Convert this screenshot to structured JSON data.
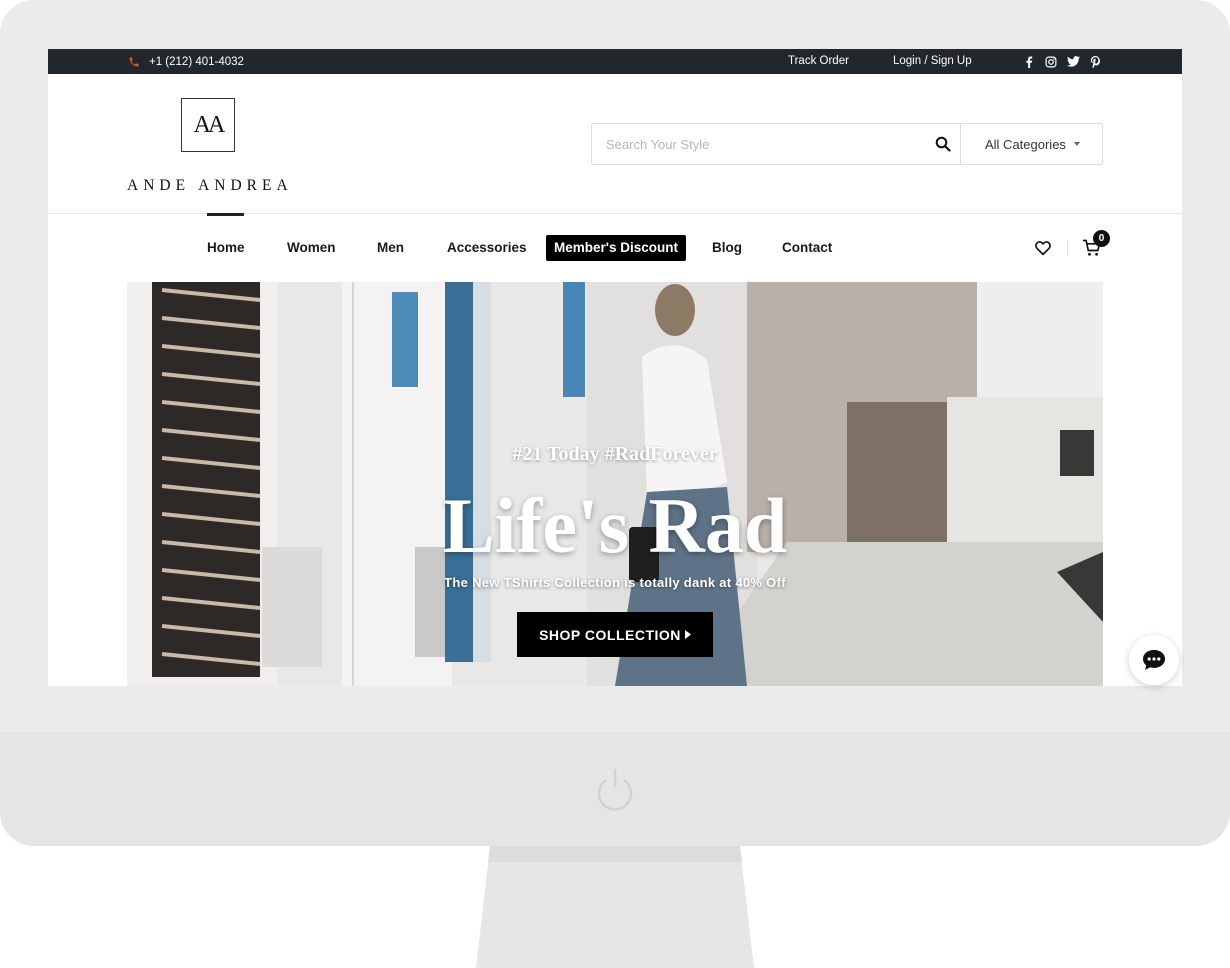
{
  "topbar": {
    "phone": "+1 (212) 401-4032",
    "track_order": "Track Order",
    "login": "Login / Sign Up",
    "social_icons": [
      "facebook-icon",
      "instagram-icon",
      "twitter-icon",
      "pinterest-icon"
    ]
  },
  "header": {
    "logo_mark": "AA",
    "logo_text": "ANDE ANDREA",
    "search_placeholder": "Search Your Style",
    "category": "All Categories"
  },
  "nav": {
    "items": [
      "Home",
      "Women",
      "Men",
      "Accessories",
      "Member's Discount",
      "Blog",
      "Contact"
    ],
    "active": "Home",
    "cart_count": "0"
  },
  "hero": {
    "tag": "#21 Today #RadForever",
    "headline": "Life's Rad",
    "sub": "The New TShirts Collection is totally dank at 40% Off",
    "cta": "SHOP COLLECTION"
  },
  "colors": {
    "topbar_bg": "#22272b",
    "phone_icon": "#e8503a",
    "button_bg": "#000000"
  }
}
